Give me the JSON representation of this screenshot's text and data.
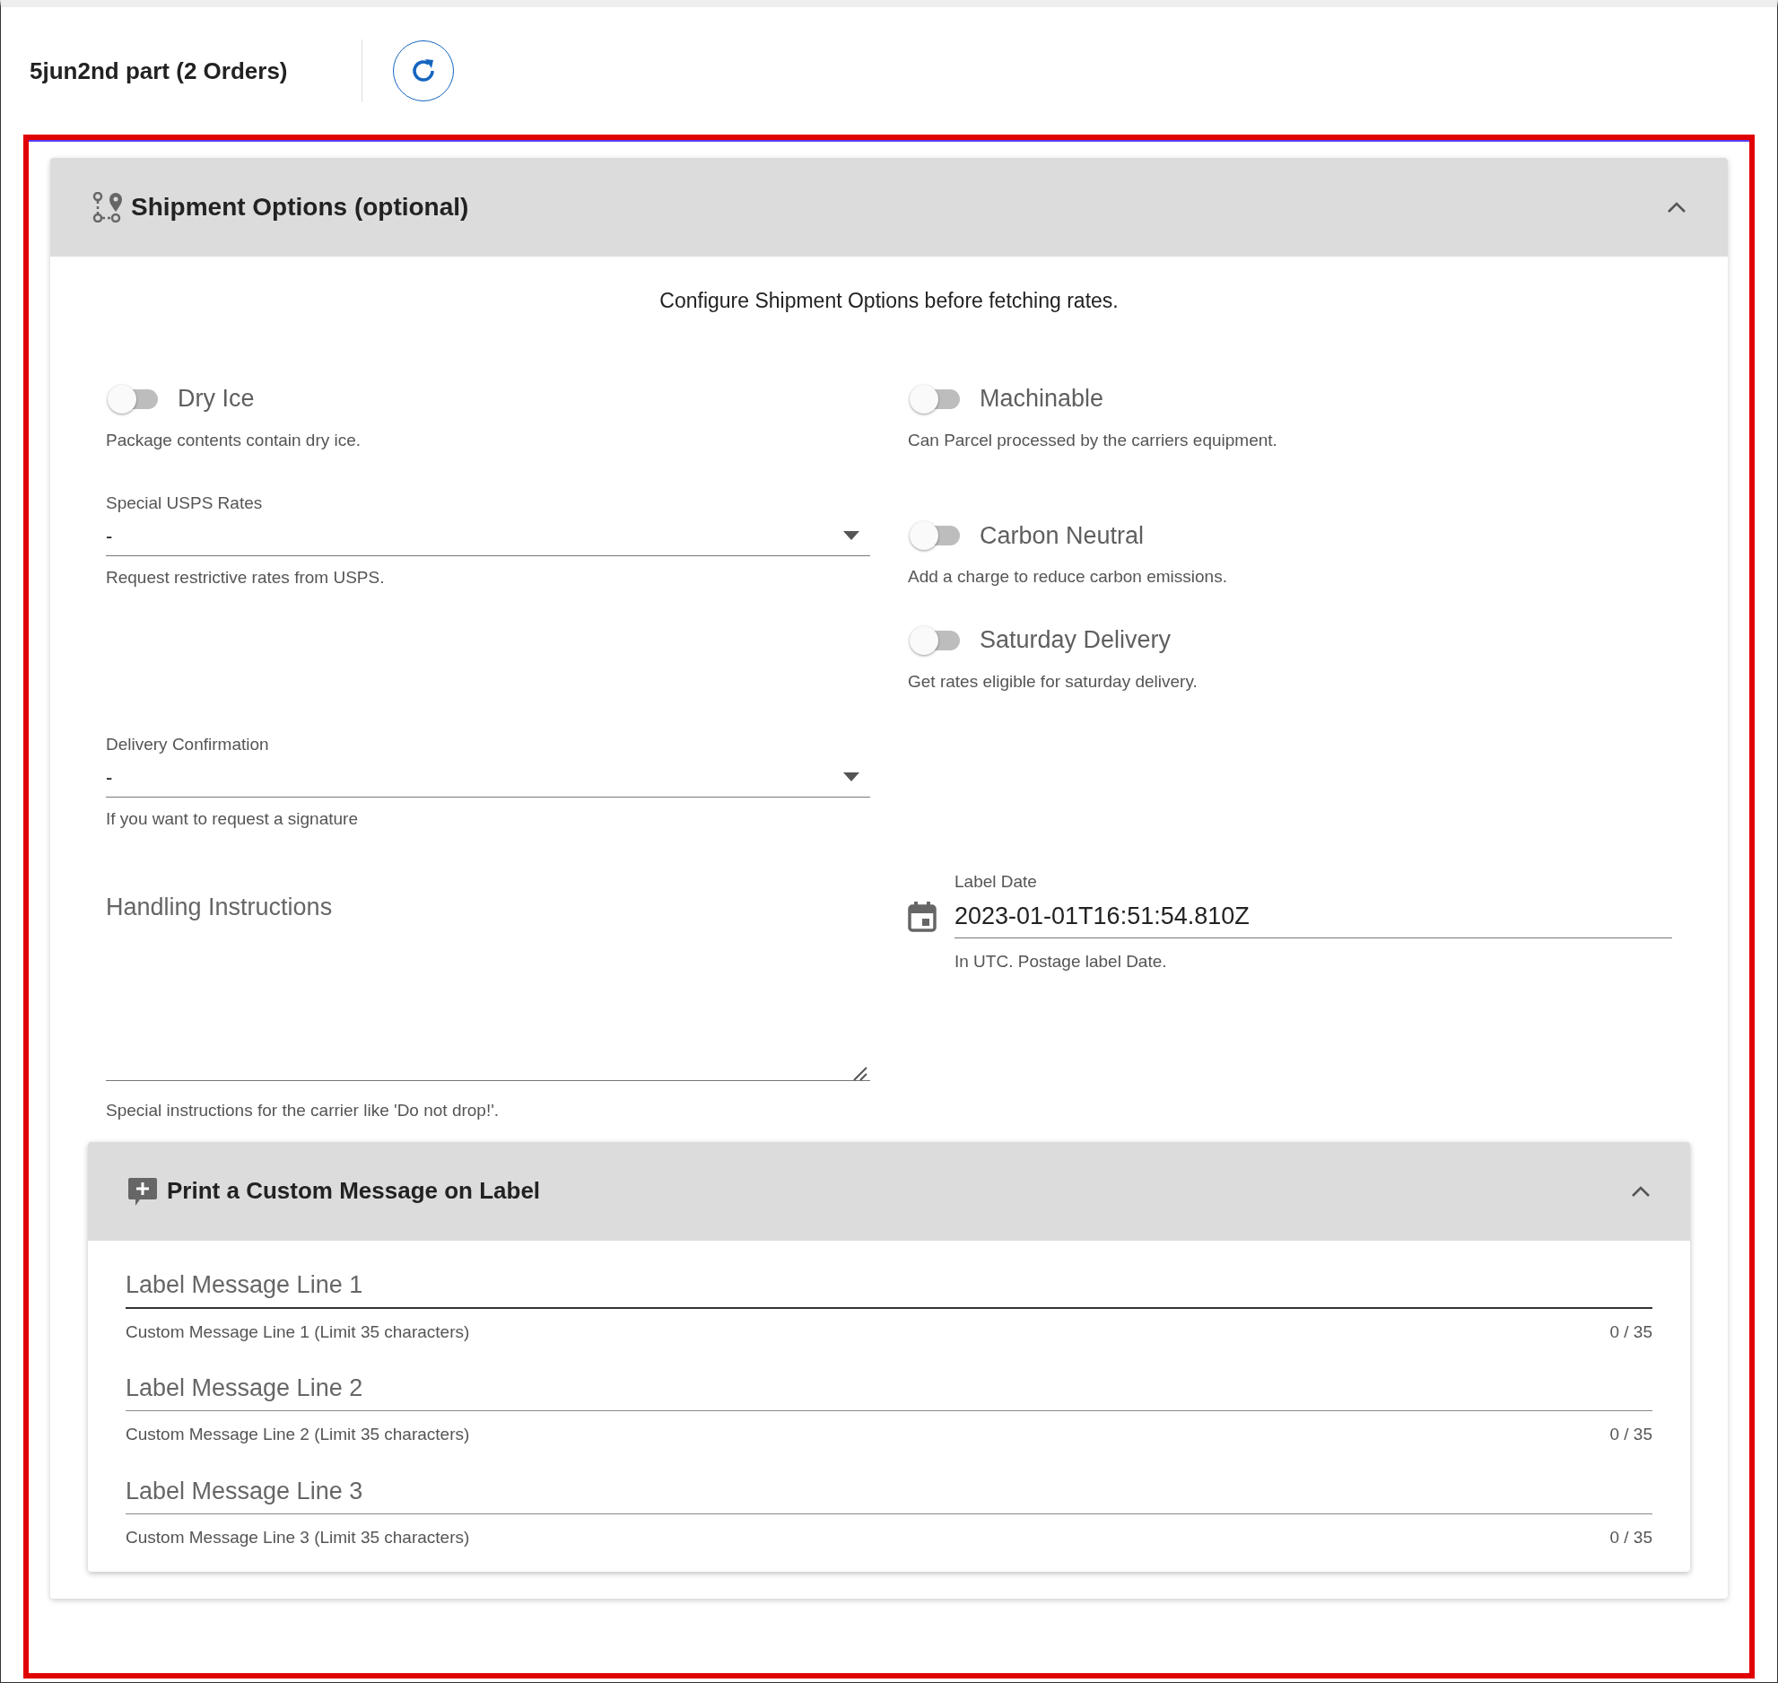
{
  "header": {
    "title": "5jun2nd part (2 Orders)"
  },
  "shipment_options": {
    "title": "Shipment Options (optional)",
    "expanded": true,
    "intro": "Configure Shipment Options before fetching rates.",
    "rows": [
      {
        "left": [
          {
            "kind": "toggle",
            "label": "Dry Ice",
            "on": false,
            "helper": "Package contents contain dry ice."
          }
        ],
        "right": [
          {
            "kind": "toggle",
            "label": "Machinable",
            "on": false,
            "helper": "Can Parcel processed by the carriers equipment."
          }
        ]
      },
      {
        "left": [
          {
            "kind": "select",
            "label": "Special USPS Rates",
            "value": "-",
            "helper": "Request restrictive rates from USPS."
          }
        ],
        "right": [
          {
            "kind": "toggle",
            "label": "Carbon Neutral",
            "on": false,
            "helper": "Add a charge to reduce carbon emissions."
          },
          {
            "kind": "toggle",
            "label": "Saturday Delivery",
            "on": false,
            "helper": "Get rates eligible for saturday delivery."
          }
        ]
      },
      {
        "left": [
          {
            "kind": "select",
            "label": "Delivery Confirmation",
            "value": "-",
            "helper": "If you want to request a signature"
          }
        ],
        "right": []
      },
      {
        "left": [
          {
            "kind": "textarea",
            "placeholder": "Handling Instructions",
            "helper": "Special instructions for the carrier like 'Do not drop!'."
          }
        ],
        "right": [
          {
            "kind": "date",
            "label": "Label Date",
            "value": "2023-01-01T16:51:54.810Z",
            "helper": "In UTC. Postage label Date."
          }
        ]
      }
    ],
    "custom_message": {
      "title": "Print a Custom Message on Label",
      "expanded": true,
      "fields": [
        {
          "placeholder": "Label Message Line 1",
          "helper": "Custom Message Line 1 (Limit 35 characters)",
          "counter": "0 / 35",
          "hovered": true
        },
        {
          "placeholder": "Label Message Line 2",
          "helper": "Custom Message Line 2 (Limit 35 characters)",
          "counter": "0 / 35",
          "hovered": false
        },
        {
          "placeholder": "Label Message Line 3",
          "helper": "Custom Message Line 3 (Limit 35 characters)",
          "counter": "0 / 35",
          "hovered": false
        }
      ]
    }
  }
}
